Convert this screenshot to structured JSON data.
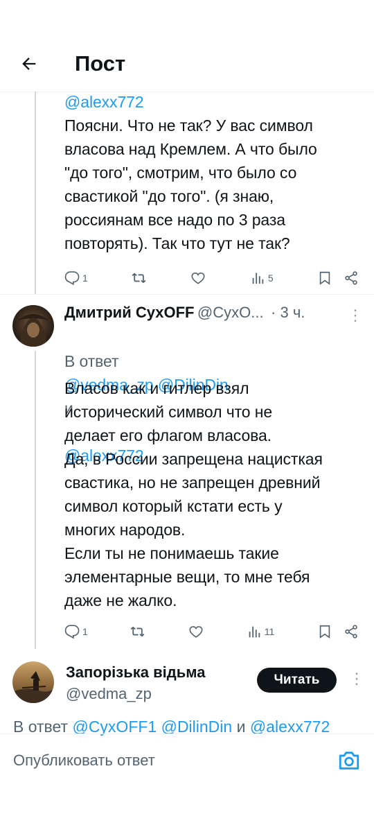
{
  "header": {
    "title": "Пост"
  },
  "tweet1": {
    "mention": "@alexx772",
    "text": "Поясни. Что не так? У вас символ\nвласова над Кремлем. А что было\n\"до того\", смотрим, что было со\nсвастикой \"до того\". (я знаю,\nроссиянам все надо по 3 раза\nповторять). Так что тут не так?",
    "reply_count": "1",
    "views": "5"
  },
  "tweet2": {
    "name": "Дмитрий СухOFF",
    "handle": "@СухО...",
    "time": "· 3 ч.",
    "reply_prefix": "В ответ",
    "reply_mentions": "@vedma_zp @DilinDin",
    "reply_and": "и",
    "reply_mention_last": "@alexx772",
    "text": "Власов как и гитлер взял\nисторический символ что не\nделает его флагом власова.\nДа, в России запрещена нацисткая\nсвастика, но не запрещен древний\nсимвол который кстати есть у\nмногих народов.\nЕсли ты не понимаешь такие\nэлементарные вещи, то мне тебя\nдаже не жалко.",
    "reply_count": "1",
    "views": "11"
  },
  "tweet3": {
    "name": "Запорізька відьма",
    "handle": "@vedma_zp",
    "follow_label": "Читать",
    "reply_prefix": "В ответ",
    "reply_mentions": "@CyxOFF1 @DilinDin",
    "reply_and": "и",
    "reply_mention_last": "@alexx772"
  },
  "compose": {
    "placeholder": "Опубликовать ответ"
  },
  "colors": {
    "accent": "#1d9bf0",
    "text": "#0f1419",
    "muted": "#536471"
  }
}
